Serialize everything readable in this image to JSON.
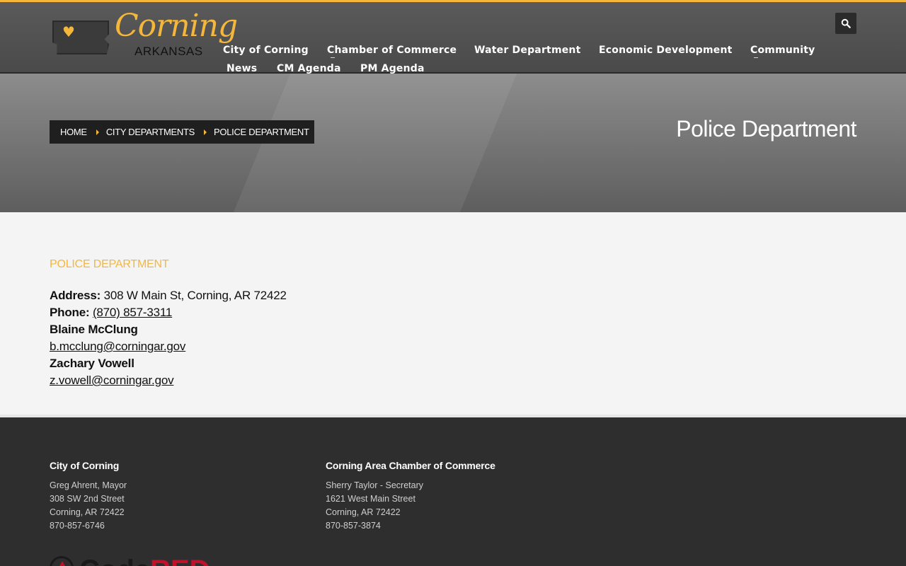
{
  "brand": {
    "logo_word": "Corning",
    "logo_sub": "ARKANSAS",
    "accent_color": "#f4b73b"
  },
  "nav": {
    "items": [
      {
        "label": "City of Corning"
      },
      {
        "label": "Chamber of Commerce"
      },
      {
        "label": "Water Department"
      },
      {
        "label": "Economic Development"
      },
      {
        "label": "Community"
      },
      {
        "label": "News"
      },
      {
        "label": "CM Agenda"
      },
      {
        "label": "PM Agenda"
      }
    ],
    "search_icon": "search-icon"
  },
  "breadcrumb": {
    "items": [
      "HOME",
      "CITY DEPARTMENTS",
      "POLICE DEPARTMENT"
    ]
  },
  "hero": {
    "title": "Police Department"
  },
  "content": {
    "section_title": "POLICE DEPARTMENT",
    "address_label": "Address:",
    "address_value": "308 W Main St, Corning, AR 72422",
    "phone_label": "Phone:",
    "phone_value": "(870) 857-3311",
    "contacts": [
      {
        "name": "Blaine McClung",
        "email": "b.mcclung@corningar.gov"
      },
      {
        "name": "Zachary Vowell",
        "email": "z.vowell@corningar.gov"
      }
    ]
  },
  "footer": {
    "columns": [
      {
        "title": "City of Corning",
        "lines": [
          "Greg Ahrent, Mayor",
          "308 SW 2nd Street",
          "Corning, AR 72422",
          "870-857-6746"
        ]
      },
      {
        "title": "Corning Area Chamber of Commerce",
        "lines": [
          "Sherry Taylor - Secretary",
          "1621 West Main Street",
          "Corning, AR 72422",
          "870-857-3874"
        ]
      }
    ],
    "codered_code": "Code",
    "codered_red": "RED"
  }
}
